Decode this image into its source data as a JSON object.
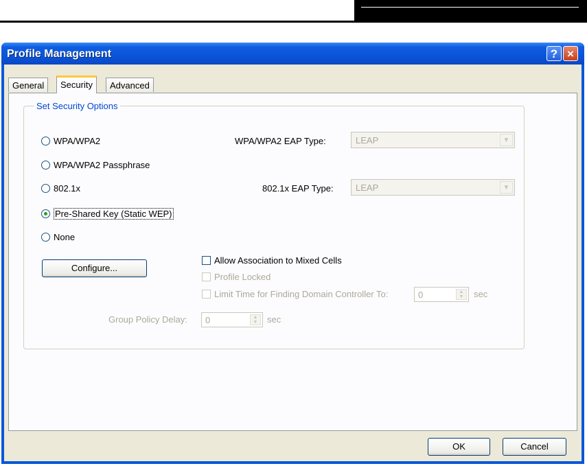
{
  "window": {
    "title": "Profile Management",
    "help_label": "?",
    "close_label": "×"
  },
  "tabs": [
    {
      "label": "General",
      "active": false
    },
    {
      "label": "Security",
      "active": true
    },
    {
      "label": "Advanced",
      "active": false
    }
  ],
  "group": {
    "legend": "Set Security Options"
  },
  "options": [
    {
      "label": "WPA/WPA2",
      "selected": false
    },
    {
      "label": "WPA/WPA2 Passphrase",
      "selected": false
    },
    {
      "label": "802.1x",
      "selected": false
    },
    {
      "label": "Pre-Shared Key (Static WEP)",
      "selected": true
    },
    {
      "label": "None",
      "selected": false
    }
  ],
  "wpa_eap": {
    "label": "WPA/WPA2 EAP Type:",
    "value": "LEAP"
  },
  "dot1x_eap": {
    "label": "802.1x EAP Type:",
    "value": "LEAP"
  },
  "configure_label": "Configure...",
  "checks": {
    "mixed_cells": "Allow Association to Mixed Cells",
    "profile_locked": "Profile Locked",
    "limit_time": "Limit Time for Finding Domain Controller To:"
  },
  "limit_time": {
    "value": "0",
    "unit": "sec"
  },
  "group_policy": {
    "label": "Group Policy Delay:",
    "value": "0",
    "unit": "sec"
  },
  "buttons": {
    "ok": "OK",
    "cancel": "Cancel"
  }
}
